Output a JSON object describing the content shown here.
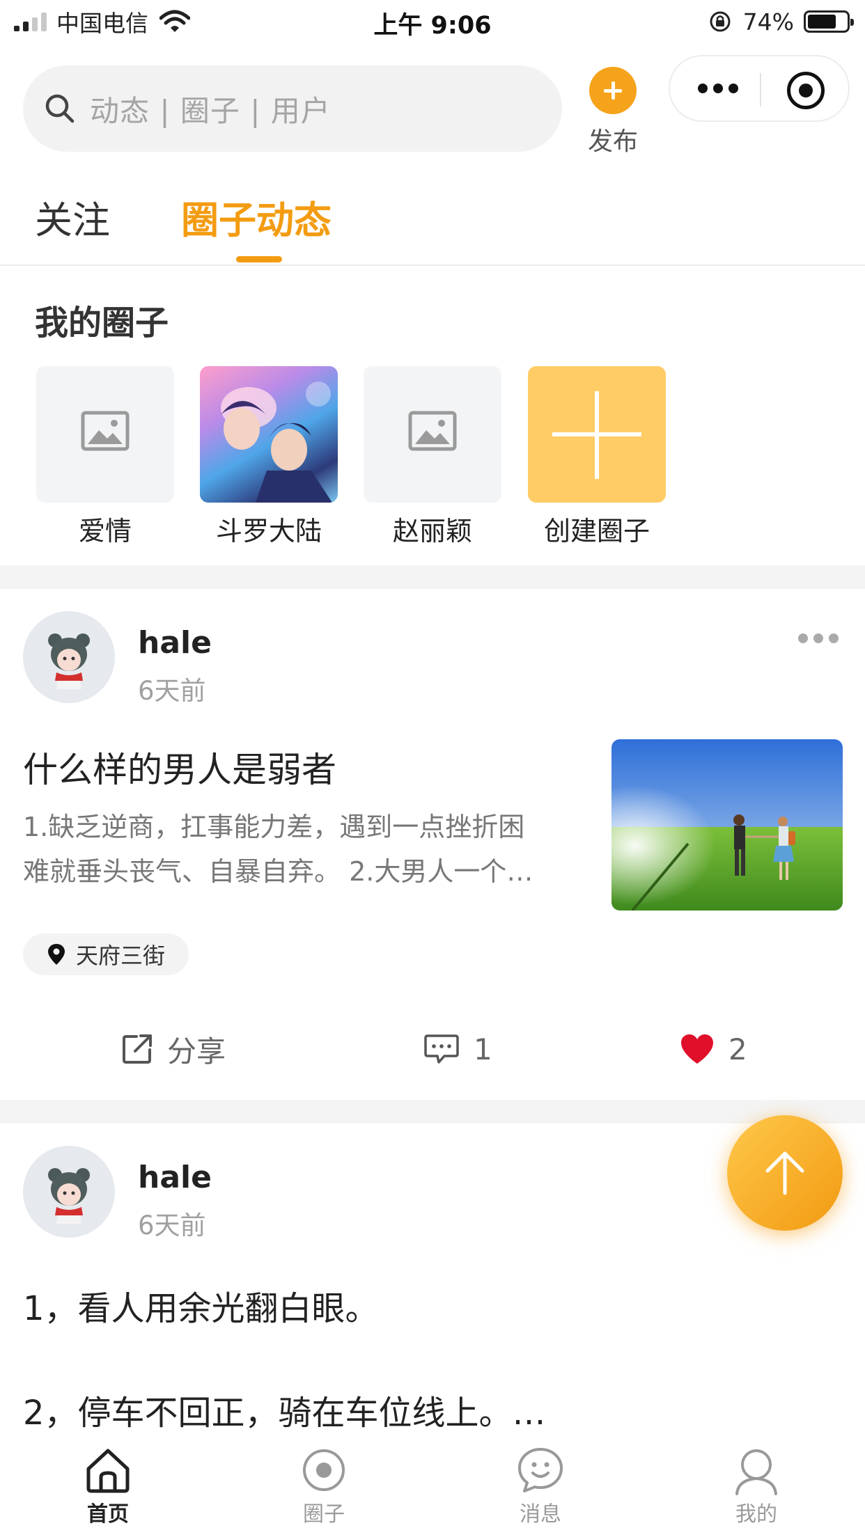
{
  "status_bar": {
    "carrier": "中国电信",
    "time": "上午 9:06",
    "battery_percent": "74%",
    "battery_level": 0.74
  },
  "header": {
    "search_placeholder": "动态 | 圈子 | 用户",
    "publish_label": "发布"
  },
  "tabs": [
    {
      "label": "关注",
      "active": false
    },
    {
      "label": "圈子动态",
      "active": true
    }
  ],
  "my_circles": {
    "title": "我的圈子",
    "items": [
      {
        "name": "爱情",
        "thumb": "image-placeholder-icon"
      },
      {
        "name": "斗罗大陆",
        "thumb": "anime-artwork"
      },
      {
        "name": "赵丽颖",
        "thumb": "image-placeholder-icon"
      },
      {
        "name": "创建圈子",
        "thumb": "plus-icon"
      }
    ]
  },
  "posts": [
    {
      "username": "hale",
      "time_ago": "6天前",
      "title": "什么样的男人是弱者",
      "excerpt_line1": "1.缺乏逆商，扛事能力差，遇到一点挫折困",
      "excerpt_line2": "难就垂头丧气、自暴自弃。 2.大男人一个…",
      "location": "天府三街",
      "share_label": "分享",
      "comment_count": "1",
      "like_count": "2"
    },
    {
      "username": "hale",
      "time_ago": "6天前",
      "line1": "1，看人用余光翻白眼。",
      "line2": "2，停车不回正，骑在车位线上。…"
    }
  ],
  "bottom_nav": [
    {
      "label": "首页",
      "icon": "home-icon",
      "active": true
    },
    {
      "label": "圈子",
      "icon": "circle-icon",
      "active": false
    },
    {
      "label": "消息",
      "icon": "message-icon",
      "active": false
    },
    {
      "label": "我的",
      "icon": "profile-icon",
      "active": false
    }
  ],
  "colors": {
    "accent": "#f39c12",
    "create_circle_bg": "#ffcc66",
    "like_red": "#e0102a"
  }
}
